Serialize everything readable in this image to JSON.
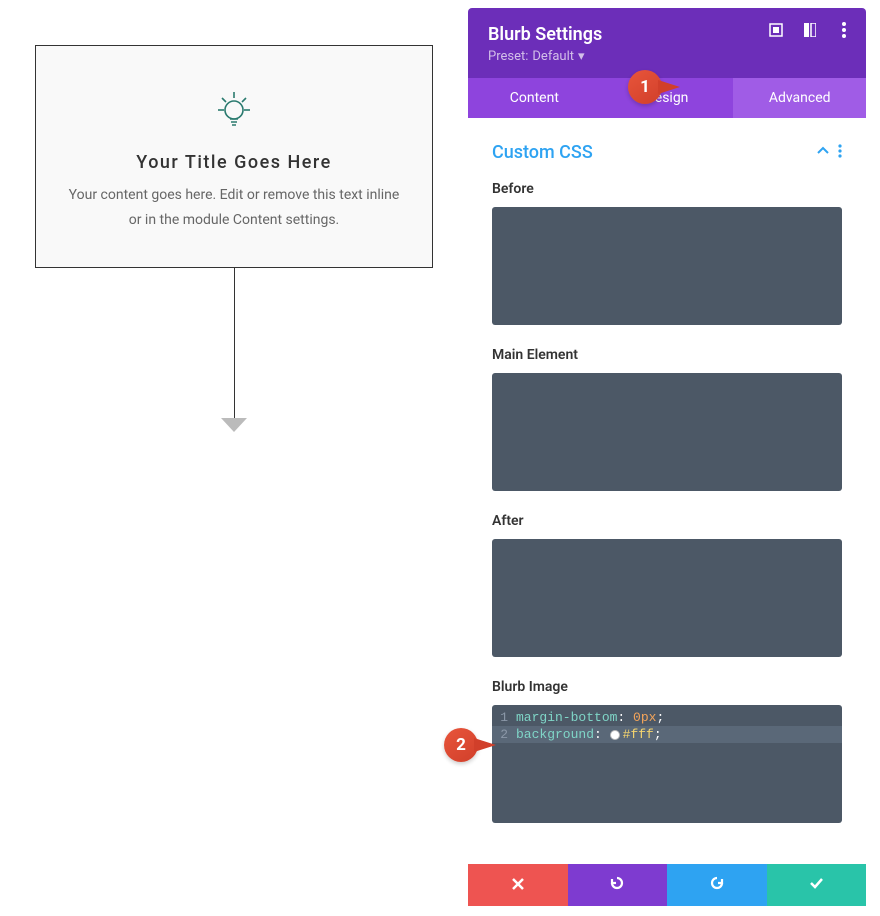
{
  "preview": {
    "title": "Your Title Goes Here",
    "content": "Your content goes here. Edit or remove this text inline or in the module Content settings."
  },
  "panel": {
    "title": "Blurb Settings",
    "preset_label": "Preset:",
    "preset_value": "Default",
    "tabs": {
      "content": "Content",
      "design": "Design",
      "advanced": "Advanced"
    },
    "section": {
      "title": "Custom CSS"
    },
    "fields": {
      "before": "Before",
      "main_element": "Main Element",
      "after": "After",
      "blurb_image": "Blurb Image"
    },
    "code": {
      "line1_num": "1",
      "line2_num": "2",
      "line1_prop": "margin-bottom",
      "line1_val": "0px",
      "line2_prop": "background",
      "line2_val": "#fff",
      "colon": ":",
      "semicolon": ";"
    }
  },
  "callouts": {
    "one": "1",
    "two": "2"
  }
}
